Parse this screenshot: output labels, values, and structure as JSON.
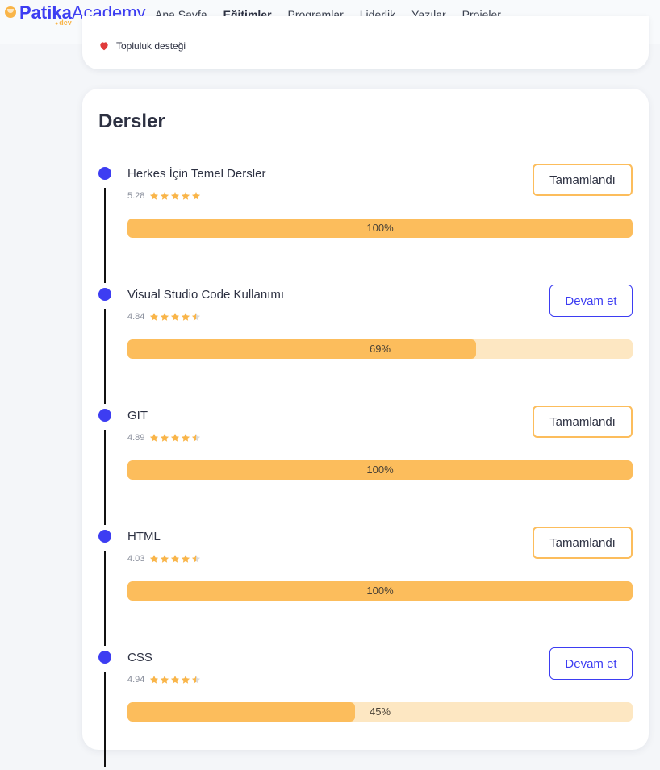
{
  "logo": {
    "primary": "Patika",
    "secondary": "Academy",
    "sub": "dev"
  },
  "nav": {
    "items": [
      "Ana Sayfa",
      "Eğitimler",
      "Programlar",
      "Liderlik",
      "Yazılar",
      "Projeler"
    ],
    "active": "Eğitimler"
  },
  "support": {
    "label": "Topluluk desteği"
  },
  "section": {
    "title": "Dersler"
  },
  "courses": [
    {
      "title": "Herkes İçin Temel Dersler",
      "rating": "5.28",
      "stars": 5,
      "progress": 100,
      "progress_label": "100%",
      "button": "Tamamlandı",
      "status": "done"
    },
    {
      "title": "Visual Studio Code Kullanımı",
      "rating": "4.84",
      "stars": 4.5,
      "progress": 69,
      "progress_label": "69%",
      "button": "Devam et",
      "status": "continue"
    },
    {
      "title": "GIT",
      "rating": "4.89",
      "stars": 4.5,
      "progress": 100,
      "progress_label": "100%",
      "button": "Tamamlandı",
      "status": "done"
    },
    {
      "title": "HTML",
      "rating": "4.03",
      "stars": 4.5,
      "progress": 100,
      "progress_label": "100%",
      "button": "Tamamlandı",
      "status": "done"
    },
    {
      "title": "CSS",
      "rating": "4.94",
      "stars": 4.5,
      "progress": 45,
      "progress_label": "45%",
      "button": "Devam et",
      "status": "continue"
    }
  ],
  "colors": {
    "accent": "#3d3df2",
    "progress_fill": "#fcbd5c",
    "progress_track": "#fde7c2",
    "star": "#f9b549",
    "heart": "#e03a3a"
  }
}
